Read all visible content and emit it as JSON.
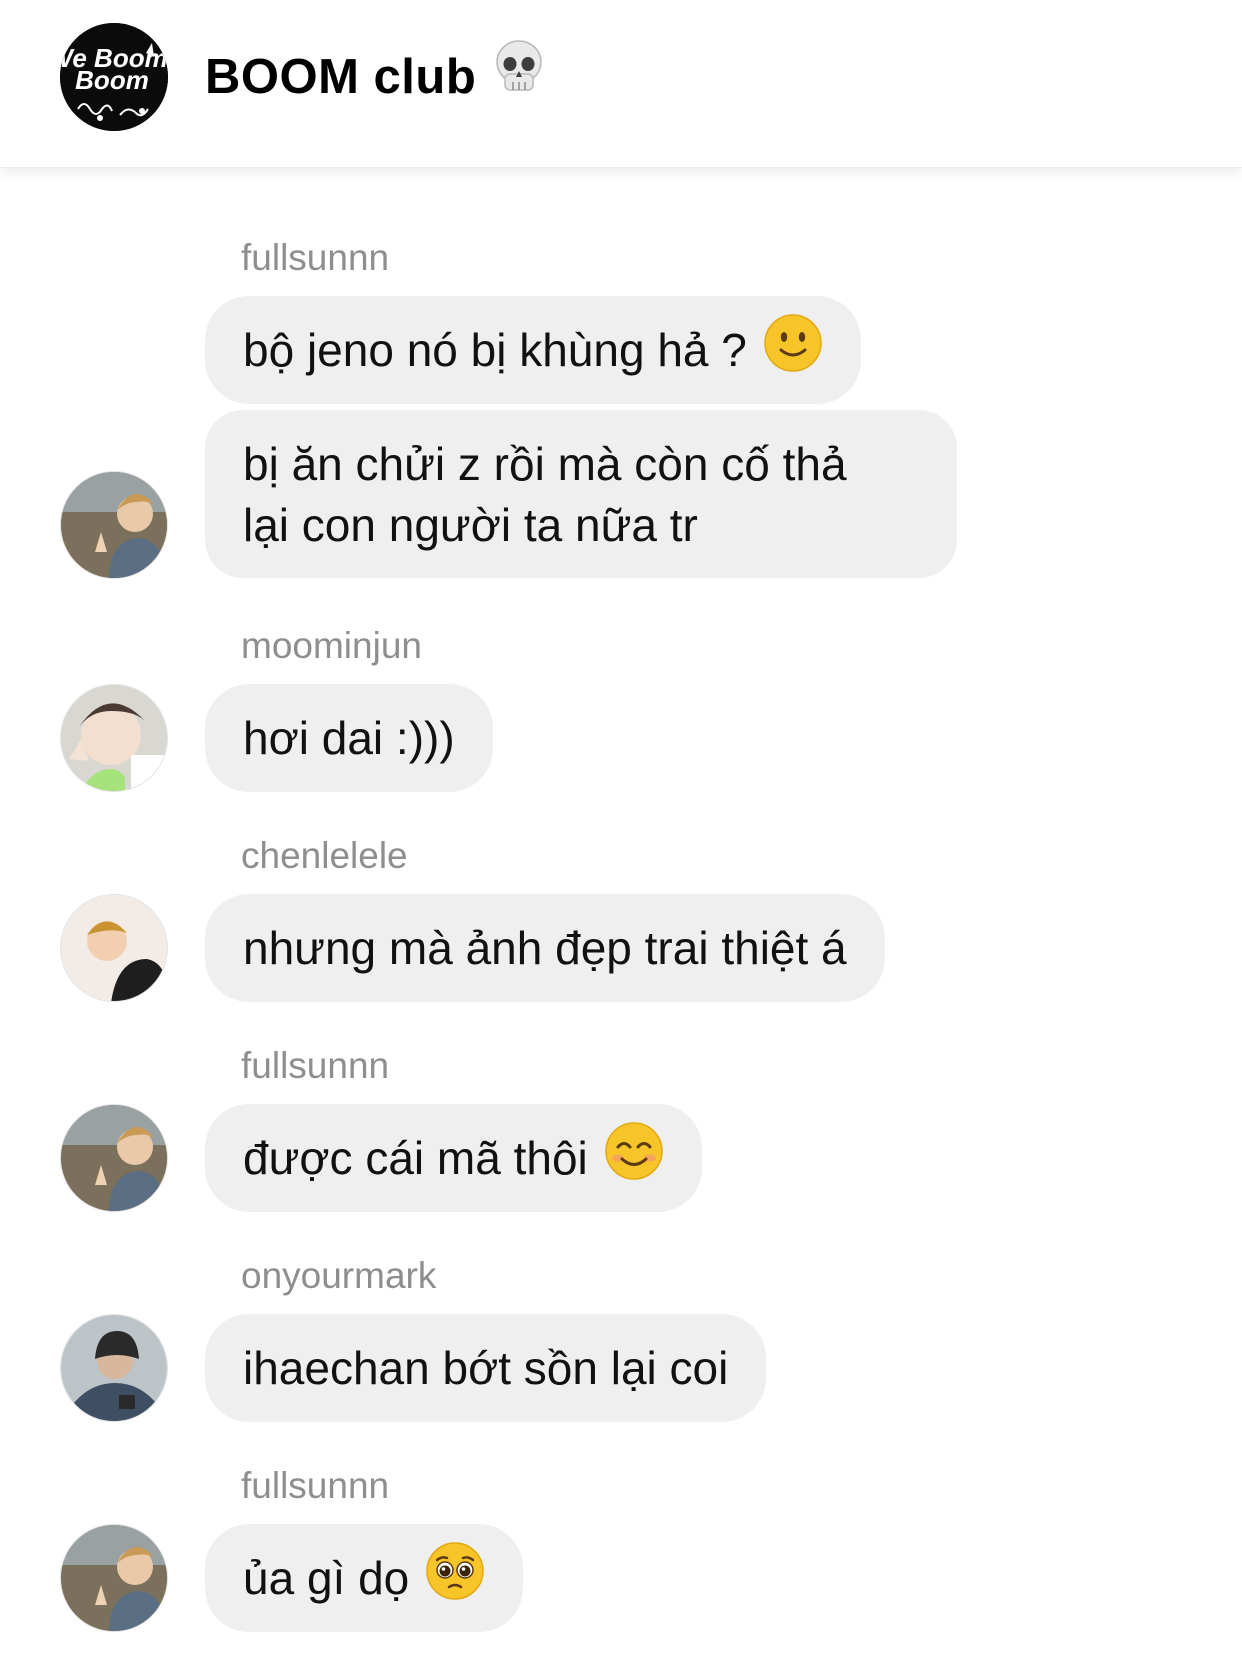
{
  "header": {
    "title": "BOOM club",
    "title_emoji": "skull-icon",
    "avatar_logo": "We Boom"
  },
  "messages": [
    {
      "sender": "fullsunnn",
      "text": "bộ jeno nó bị khùng hả ?",
      "emoji": "slightly-smiling-face-icon"
    },
    {
      "text_lines": [
        "bị ăn chửi z rồi mà còn cố thả",
        "lại con người ta nữa tr"
      ]
    },
    {
      "sender": "moominjun",
      "text": "hơi dai :)))"
    },
    {
      "sender": "chenlelele",
      "text": "nhưng mà ảnh đẹp trai thiệt á"
    },
    {
      "sender": "fullsunnn",
      "text": "được cái mã thôi",
      "emoji": "smiling-face-with-smiling-eyes-icon"
    },
    {
      "sender": "onyourmark",
      "text": "ihaechan bớt sồn lại coi"
    },
    {
      "sender": "fullsunnn",
      "text": "ủa gì dọ",
      "emoji": "pleading-face-icon"
    }
  ],
  "colors": {
    "bubble": "#efefef",
    "sender": "#8e8e8e",
    "emoji_yellow": "#f7c528"
  }
}
